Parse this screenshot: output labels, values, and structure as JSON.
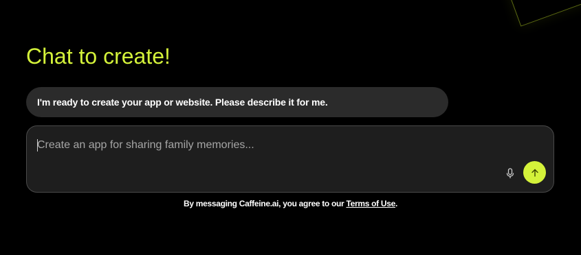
{
  "colors": {
    "accent": "#d4f23a",
    "background": "#000000",
    "bubble": "#2b2b2b",
    "composer": "#1e1e1e"
  },
  "header": {
    "title": "Chat to create!"
  },
  "chat": {
    "assistant_message": "I'm ready to create your app or website. Please describe it for me."
  },
  "composer": {
    "placeholder": "Create an app for sharing family memories...",
    "value": "",
    "mic_icon": "microphone-icon",
    "send_icon": "arrow-up-icon"
  },
  "footer": {
    "terms_prefix": "By messaging Caffeine.ai, you agree to our ",
    "terms_link": "Terms of Use",
    "terms_suffix": "."
  }
}
